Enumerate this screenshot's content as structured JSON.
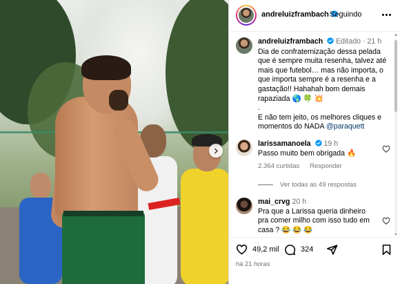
{
  "post": {
    "username": "andreluizframbach",
    "follow_status": "Seguindo",
    "caption": {
      "username": "andreluizframbach",
      "edited_label": "Editado",
      "time": "21 h",
      "text": "Dia de confraternização dessa pelada que é sempre muita resenha, talvez até mais que futebol… mas não importa, o que importa sempre é a resenha e a gastação!! Hahahah bom demais rapaziada 🌎 🍀 💥\n.\nE não tem jeito, os melhores cliques e momentos do NADA",
      "mention": "@paraquett"
    },
    "comments": [
      {
        "username": "larissamanoela",
        "time": "19 h",
        "text": "Passo muito bem obrigada 🔥",
        "likes": "2.364 curtidas",
        "reply_label": "Responder",
        "view_replies": "Ver todas as 49 respostas"
      },
      {
        "username": "mai_crvg",
        "time": "20 h",
        "text": "Pra que a Larissa queria dinheiro pra comer milho com isso tudo em casa ? 😂 😂 😂"
      }
    ],
    "actions": {
      "likes_count": "49,2 mil",
      "comments_count": "324",
      "posted_ago": "há 21 horas"
    }
  },
  "icons": {
    "verified": "verified-badge-icon",
    "more": "more-options-icon",
    "heart": "heart-icon",
    "comment": "comment-icon",
    "share": "share-icon",
    "save": "bookmark-icon",
    "next": "chevron-right-icon"
  },
  "colors": {
    "verified_blue": "#0095f6",
    "muted": "#737373",
    "mention": "#00376b"
  }
}
